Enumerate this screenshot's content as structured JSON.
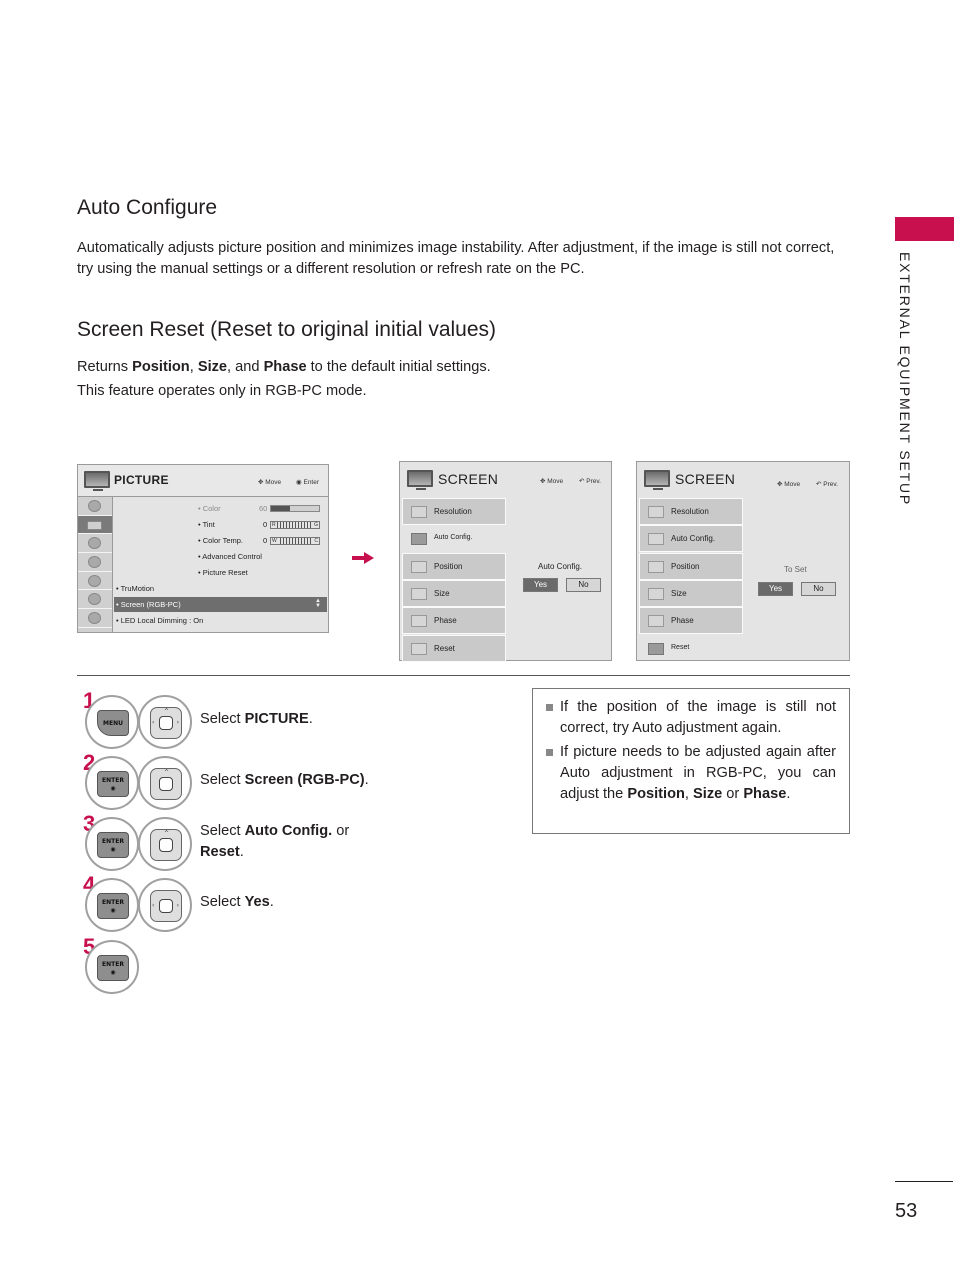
{
  "side_tab": {
    "label": "EXTERNAL EQUIPMENT SETUP",
    "accent": "#c8104e"
  },
  "auto_configure": {
    "heading": "Auto Configure",
    "body": "Automatically adjusts picture position and minimizes image instability. After adjustment, if the image is still not correct, try using the manual settings or a different resolution or refresh rate on the PC."
  },
  "screen_reset": {
    "heading": "Screen Reset (Reset to original initial values)",
    "line1": {
      "prefix": "Returns ",
      "b1": "Position",
      "sep1": ", ",
      "b2": "Size",
      "sep2": ", and ",
      "b3": "Phase",
      "suffix": " to the default initial settings."
    },
    "line2": "This feature operates only in RGB-PC mode."
  },
  "picture_osd": {
    "title": "PICTURE",
    "hint_move": "Move",
    "hint_enter": "Enter",
    "side_icons": [
      "picture-mode-icon",
      "picture-icon",
      "audio-icon",
      "time-icon",
      "lock-icon",
      "option-icon",
      "input-icon"
    ],
    "items": [
      {
        "label": "• Color",
        "value": "60",
        "dim": true
      },
      {
        "label": "• Tint",
        "value": "0",
        "scale_left": "R",
        "scale_right": "G"
      },
      {
        "label": "• Color Temp.",
        "value": "0",
        "scale_left": "W",
        "scale_right": "C"
      },
      {
        "label": "• Advanced Control"
      },
      {
        "label": "• Picture Reset"
      },
      {
        "label": "• TruMotion"
      },
      {
        "label": "• Screen (RGB-PC)",
        "selected": true
      },
      {
        "label": "• LED Local Dimming : On"
      }
    ],
    "color_level_percent": 40
  },
  "screen_osd_1": {
    "title": "SCREEN",
    "hint_move": "Move",
    "hint_prev": "Prev.",
    "items": [
      "Resolution",
      "Auto Config.",
      "Position",
      "Size",
      "Phase",
      "Reset"
    ],
    "active_item": "Auto Config.",
    "prompt": "Auto Config.",
    "yes": "Yes",
    "no": "No"
  },
  "screen_osd_2": {
    "title": "SCREEN",
    "hint_move": "Move",
    "hint_prev": "Prev.",
    "items": [
      "Resolution",
      "Auto Config.",
      "Position",
      "Size",
      "Phase",
      "Reset"
    ],
    "active_item": "Reset",
    "prompt": "To Set",
    "yes": "Yes",
    "no": "No"
  },
  "steps": [
    {
      "num": "1",
      "key": "MENU",
      "pad": "4-way",
      "text_prefix": "Select ",
      "bold": "PICTURE",
      "text_suffix": "."
    },
    {
      "num": "2",
      "key": "ENTER",
      "pad": "up-down",
      "text_prefix": "Select ",
      "bold": "Screen (RGB-PC)",
      "text_suffix": "."
    },
    {
      "num": "3",
      "key": "ENTER",
      "pad": "up-down",
      "text_prefix": "Select ",
      "bold": "Auto Config.",
      "text_mid": " or",
      "bold2": "Reset",
      "text_suffix": "."
    },
    {
      "num": "4",
      "key": "ENTER",
      "pad": "left-right",
      "text_prefix": "Select ",
      "bold": "Yes",
      "text_suffix": "."
    },
    {
      "num": "5",
      "key": "ENTER"
    }
  ],
  "notes": {
    "n1": "If the position of the image is still not correct, try Auto adjustment again.",
    "n2_prefix": "If picture needs to be adjusted again after Auto adjustment in RGB-PC, you can adjust the ",
    "n2_b1": "Position",
    "n2_sep1": ", ",
    "n2_b2": "Size",
    "n2_sep2": " or ",
    "n2_b3": "Phase",
    "n2_suffix": "."
  },
  "page_number": "53"
}
